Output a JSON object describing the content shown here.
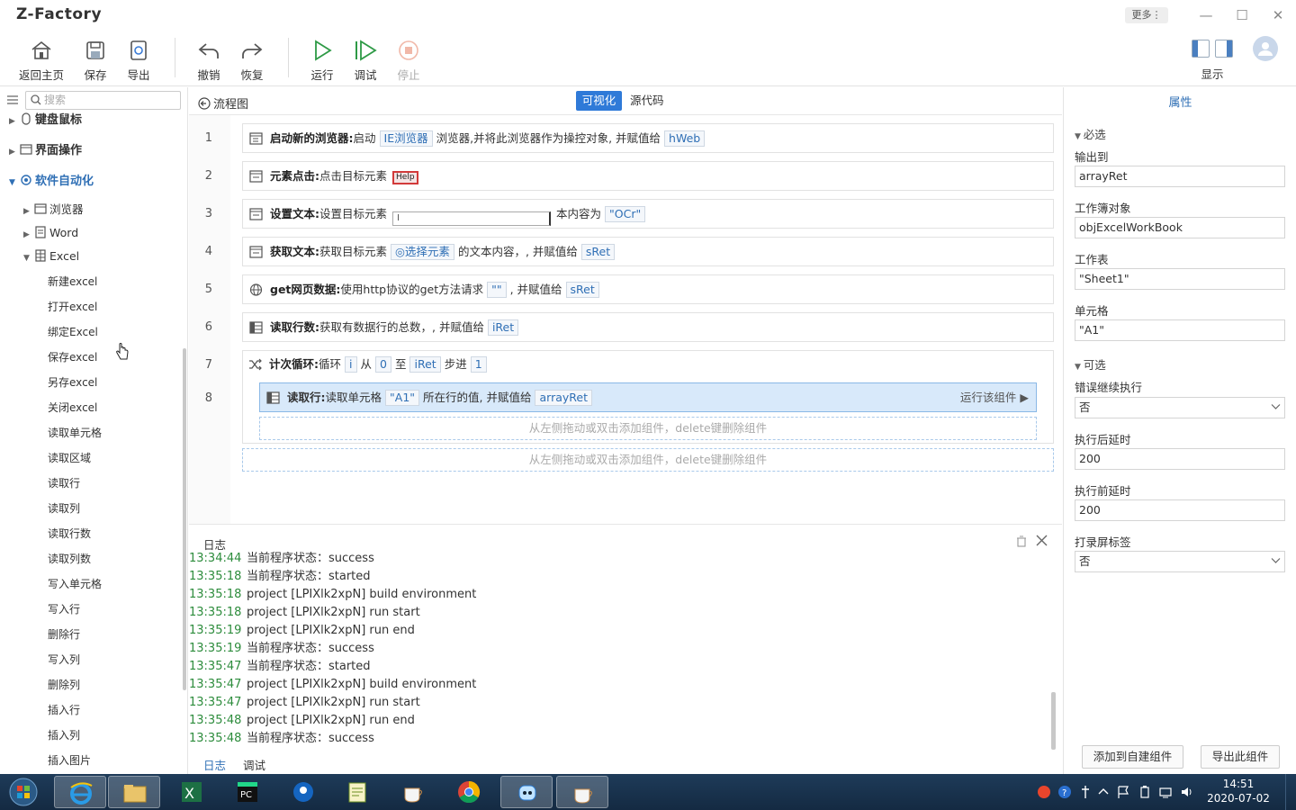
{
  "app": {
    "title": "Z-Factory",
    "more_label": "更多⋮"
  },
  "toolbar": {
    "home": "返回主页",
    "save": "保存",
    "export": "导出",
    "undo": "撤销",
    "redo": "恢复",
    "run": "运行",
    "debug": "调试",
    "stop": "停止",
    "display": "显示"
  },
  "sidebar": {
    "search_placeholder": "搜索",
    "cat_keyboard": "键盘鼠标",
    "cat_ui": "界面操作",
    "cat_software": "软件自动化",
    "sub_browser": "浏览器",
    "sub_word": "Word",
    "sub_excel": "Excel",
    "excel_items": [
      "新建excel",
      "打开excel",
      "绑定Excel",
      "保存excel",
      "另存excel",
      "关闭excel",
      "读取单元格",
      "读取区域",
      "读取行",
      "读取列",
      "读取行数",
      "读取列数",
      "写入单元格",
      "写入行",
      "删除行",
      "写入列",
      "删除列",
      "插入行",
      "插入列",
      "插入图片"
    ]
  },
  "center": {
    "flow_title": "流程图",
    "tab_visual": "可视化",
    "tab_source": "源代码"
  },
  "steps": [
    {
      "num": "1",
      "name": "启动新的浏览器:",
      "t1": "启动",
      "v1": "IE浏览器",
      "t2": "浏览器,并将此浏览器作为操控对象, 并赋值给",
      "v2": "hWeb"
    },
    {
      "num": "2",
      "name": "元素点击:",
      "t1": "点击目标元素",
      "v1": "Help"
    },
    {
      "num": "3",
      "name": "设置文本:",
      "t1": "设置目标元素",
      "v1": "I",
      "t2": "本内容为",
      "v2": "\"OCr\""
    },
    {
      "num": "4",
      "name": "获取文本:",
      "t1": "获取目标元素",
      "v1": "◎选择元素",
      "t2": "的文本内容，, 并赋值给",
      "v2": "sRet"
    },
    {
      "num": "5",
      "name": "get网页数据:",
      "t1": "使用http协议的get方法请求",
      "v1": "\"\"",
      "t2": ", 并赋值给",
      "v2": "sRet"
    },
    {
      "num": "6",
      "name": "读取行数:",
      "t1": "获取有数据行的总数，, 并赋值给",
      "v1": "iRet"
    },
    {
      "num": "7",
      "name": "计次循环:",
      "t1": "循环",
      "v1": "i",
      "t2": "从",
      "v2": "0",
      "t3": "至",
      "v3": "iRet",
      "t4": "步进",
      "v4": "1"
    },
    {
      "num": "8",
      "name": "读取行:",
      "t1": "读取单元格",
      "v1": "\"A1\"",
      "t2": "所在行的值, 并赋值给",
      "v2": "arrayRet",
      "run": "运行该组件 ▶"
    }
  ],
  "dropzone_text": "从左侧拖动或双击添加组件，delete键删除组件",
  "log": {
    "title": "日志",
    "lines": [
      {
        "t": "13:34:44",
        "m": "当前程序状态：success"
      },
      {
        "t": "13:35:18",
        "m": "当前程序状态：started"
      },
      {
        "t": "13:35:18",
        "m": "project [LPIXlk2xpN] build environment"
      },
      {
        "t": "13:35:18",
        "m": "project [LPIXlk2xpN] run start"
      },
      {
        "t": "13:35:19",
        "m": "project [LPIXlk2xpN] run end"
      },
      {
        "t": "13:35:19",
        "m": "当前程序状态：success"
      },
      {
        "t": "13:35:47",
        "m": "当前程序状态：started"
      },
      {
        "t": "13:35:47",
        "m": "project [LPIXlk2xpN] build environment"
      },
      {
        "t": "13:35:47",
        "m": "project [LPIXlk2xpN] run start"
      },
      {
        "t": "13:35:48",
        "m": "project [LPIXlk2xpN] run end"
      },
      {
        "t": "13:35:48",
        "m": "当前程序状态：success"
      }
    ],
    "tab_log": "日志",
    "tab_debug": "调试"
  },
  "props": {
    "title": "属性",
    "required": "必选",
    "output_label": "输出到",
    "output_value": "arrayRet",
    "workbook_label": "工作簿对象",
    "workbook_value": "objExcelWorkBook",
    "sheet_label": "工作表",
    "sheet_value": "\"Sheet1\"",
    "cell_label": "单元格",
    "cell_value": "\"A1\"",
    "optional": "可选",
    "err_label": "错误继续执行",
    "err_value": "否",
    "after_label": "执行后延时",
    "after_value": "200",
    "before_label": "执行前延时",
    "before_value": "200",
    "record_label": "打录屏标签",
    "record_value": "否",
    "btn_add": "添加到自建组件",
    "btn_export": "导出此组件"
  },
  "taskbar": {
    "time": "14:51",
    "date": "2020-07-02"
  }
}
